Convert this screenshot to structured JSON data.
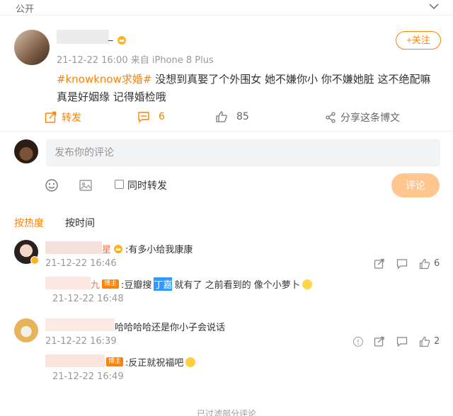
{
  "topbar": {
    "visibility": "公开"
  },
  "post": {
    "author_suffix": "_",
    "meta": "21-12-22 16:00  来自 iPhone 8 Plus",
    "follow_label": "+关注",
    "hashtag": "#knowknow求婚#",
    "body": " 没想到真娶了个外围女 她不嫌你小 你不嫌她脏 这不绝配嘛 真是好姻缘 记得婚检哦",
    "actions": {
      "repost_label": "转发",
      "comment_count": "6",
      "like_count": "85",
      "share_label": "分享这条博文"
    }
  },
  "composer": {
    "placeholder": "发布你的评论",
    "also_repost_label": "同时转发",
    "submit_label": "评论"
  },
  "sort": {
    "hot": "按热度",
    "time": "按时间"
  },
  "comments": [
    {
      "name_suffix": "星",
      "text": ":有多小给我康康",
      "time": "21-12-22 16:46",
      "likes": "6",
      "reply": {
        "name_suffix": "九",
        "badge": "博主",
        "text_before": ":豆瓣搜",
        "text_highlight": "丁嘉",
        "text_after": "就有了 之前看到的 像个小萝卜",
        "time": "21-12-22 16:48"
      }
    },
    {
      "text": "哈哈哈哈还是你小子会说话",
      "time": "21-12-22 16:39",
      "likes": "2",
      "reply": {
        "badge": "博主",
        "text": ":反正就祝福吧",
        "time": "21-12-22 16:49"
      }
    }
  ],
  "footer": {
    "note": "已过滤部分评论"
  },
  "colors": {
    "accent": "#ff8200",
    "muted": "#999999",
    "input_bg": "#f2f3f5"
  },
  "icons": [
    "chevron-down-icon",
    "crown-icon",
    "repost-icon",
    "comment-icon",
    "like-icon",
    "share-icon",
    "emoji-icon",
    "image-icon",
    "forward-icon",
    "reply-icon",
    "report-icon"
  ]
}
